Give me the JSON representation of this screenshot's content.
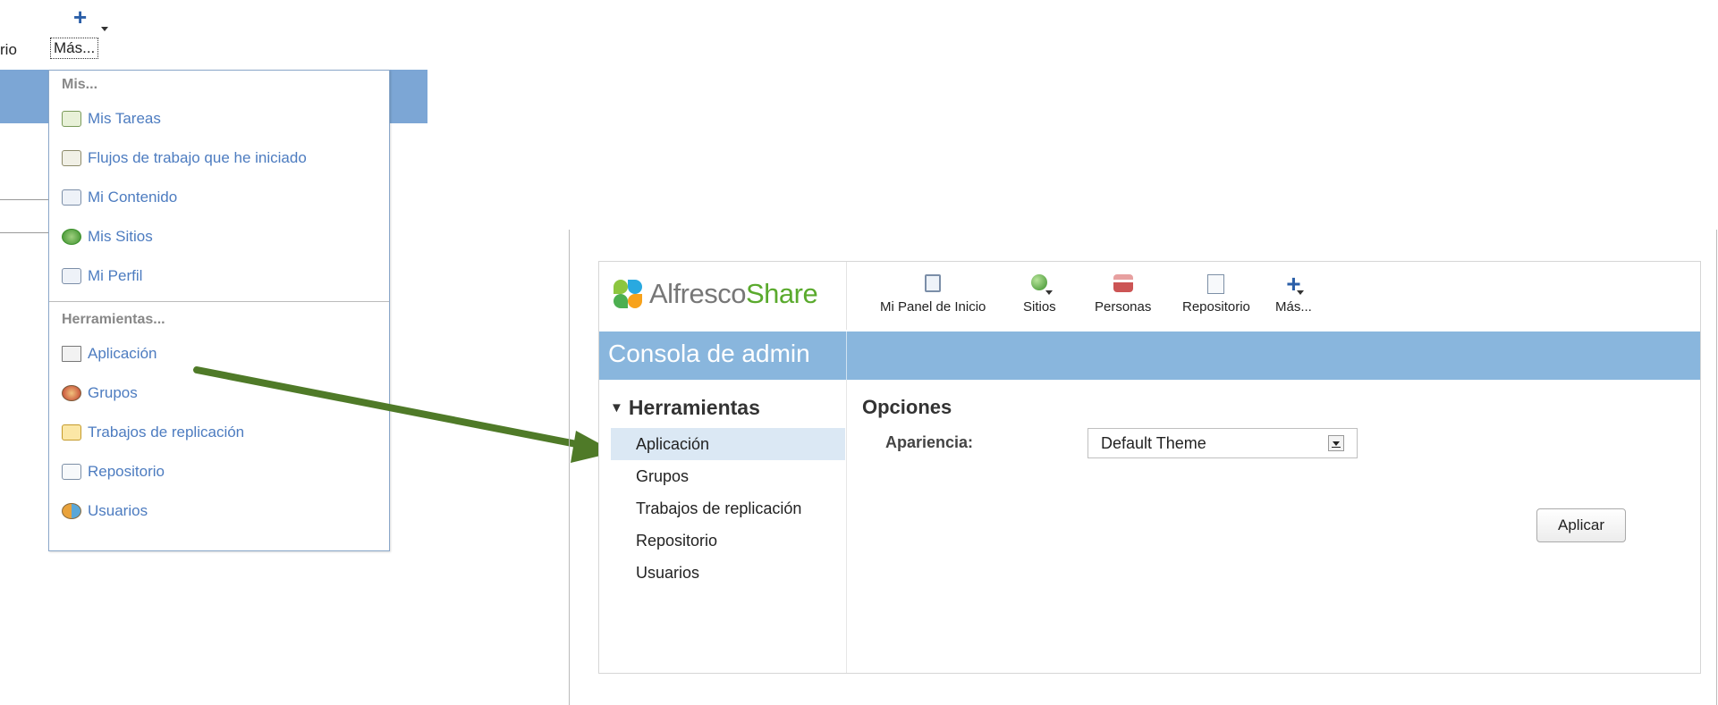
{
  "left_fragment": {
    "prev_nav_text": "rio",
    "mas_label": "Más...",
    "plus_icon": "plus-icon",
    "menu": {
      "group_mis": "Mis...",
      "mis_items": [
        {
          "label": "Mis Tareas",
          "icon": "tasks-icon"
        },
        {
          "label": "Flujos de trabajo que he iniciado",
          "icon": "workflow-icon"
        },
        {
          "label": "Mi Contenido",
          "icon": "content-icon"
        },
        {
          "label": "Mis Sitios",
          "icon": "sites-icon"
        },
        {
          "label": "Mi Perfil",
          "icon": "profile-icon"
        }
      ],
      "group_tools": "Herramientas...",
      "tool_items": [
        {
          "label": "Aplicación",
          "icon": "application-icon"
        },
        {
          "label": "Grupos",
          "icon": "groups-icon"
        },
        {
          "label": "Trabajos de replicación",
          "icon": "replication-icon"
        },
        {
          "label": "Repositorio",
          "icon": "repository-icon"
        },
        {
          "label": "Usuarios",
          "icon": "users-icon"
        }
      ]
    }
  },
  "arrow_color": "#4f7a28",
  "app": {
    "logo_main": "Alfresco",
    "logo_accent": "Share",
    "nav": [
      {
        "label": "Mi Panel de Inicio",
        "icon": "dashboard-icon"
      },
      {
        "label": "Sitios",
        "icon": "globe-icon"
      },
      {
        "label": "Personas",
        "icon": "people-icon"
      },
      {
        "label": "Repositorio",
        "icon": "repository-icon"
      },
      {
        "label": "Más...",
        "icon": "plus-icon"
      }
    ],
    "page_title": "Consola de admin",
    "sidebar": {
      "heading": "Herramientas",
      "items": [
        "Aplicación",
        "Grupos",
        "Trabajos de replicación",
        "Repositorio",
        "Usuarios"
      ],
      "active_index": 0
    },
    "options_title": "Opciones",
    "appearance_label": "Apariencia:",
    "appearance_value": "Default Theme",
    "apply_label": "Aplicar"
  },
  "colors": {
    "title_band": "#89b6dd",
    "link_blue": "#4d7cc0",
    "share_green": "#5aaa2d",
    "active_row": "#dbe8f4"
  }
}
